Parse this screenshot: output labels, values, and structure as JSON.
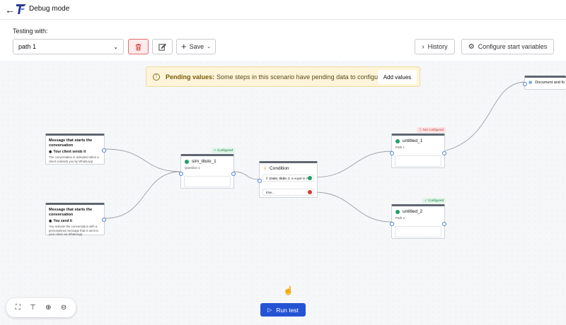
{
  "header": {
    "title": "Debug mode"
  },
  "toolbar": {
    "testing_label": "Testing with:",
    "path_value": "path 1",
    "save_label": "Save",
    "history_label": "History",
    "config_label": "Configure start variables"
  },
  "banner": {
    "title": "Pending values:",
    "text": "Some steps in this scenario have pending data to configure.",
    "button": "Add values"
  },
  "nodes": {
    "msg1": {
      "title": "Message that starts the conversation",
      "sub": "Your client sends it",
      "desc": "The conversation is activated when a client contacts you by WhatsApp."
    },
    "msg2": {
      "title": "Message that starts the conversation",
      "sub": "You send it",
      "desc": "You activate the conversation with a personalized message that is sent to your client via WhatsApp."
    },
    "sim": {
      "title": "sim_titulo_1",
      "field": "Question 1",
      "badge": "Configured"
    },
    "condition": {
      "title": "Condition",
      "row1_var": "@sim_titulo_1",
      "row1_text": "is equal to Yes",
      "else": "Else..."
    },
    "untitled1": {
      "title": "untitled_1",
      "field": "Path 1",
      "badge": "Not configured"
    },
    "untitled2": {
      "title": "untitled_2",
      "field": "Path 2",
      "badge": "Configured"
    },
    "doc": {
      "title": "Document and fo"
    }
  },
  "footer": {
    "run_label": "Run test"
  },
  "colors": {
    "accent": "#2453d4",
    "danger": "#d32f2f",
    "success": "#22a06b",
    "warning_bg": "#fdf4d9"
  }
}
